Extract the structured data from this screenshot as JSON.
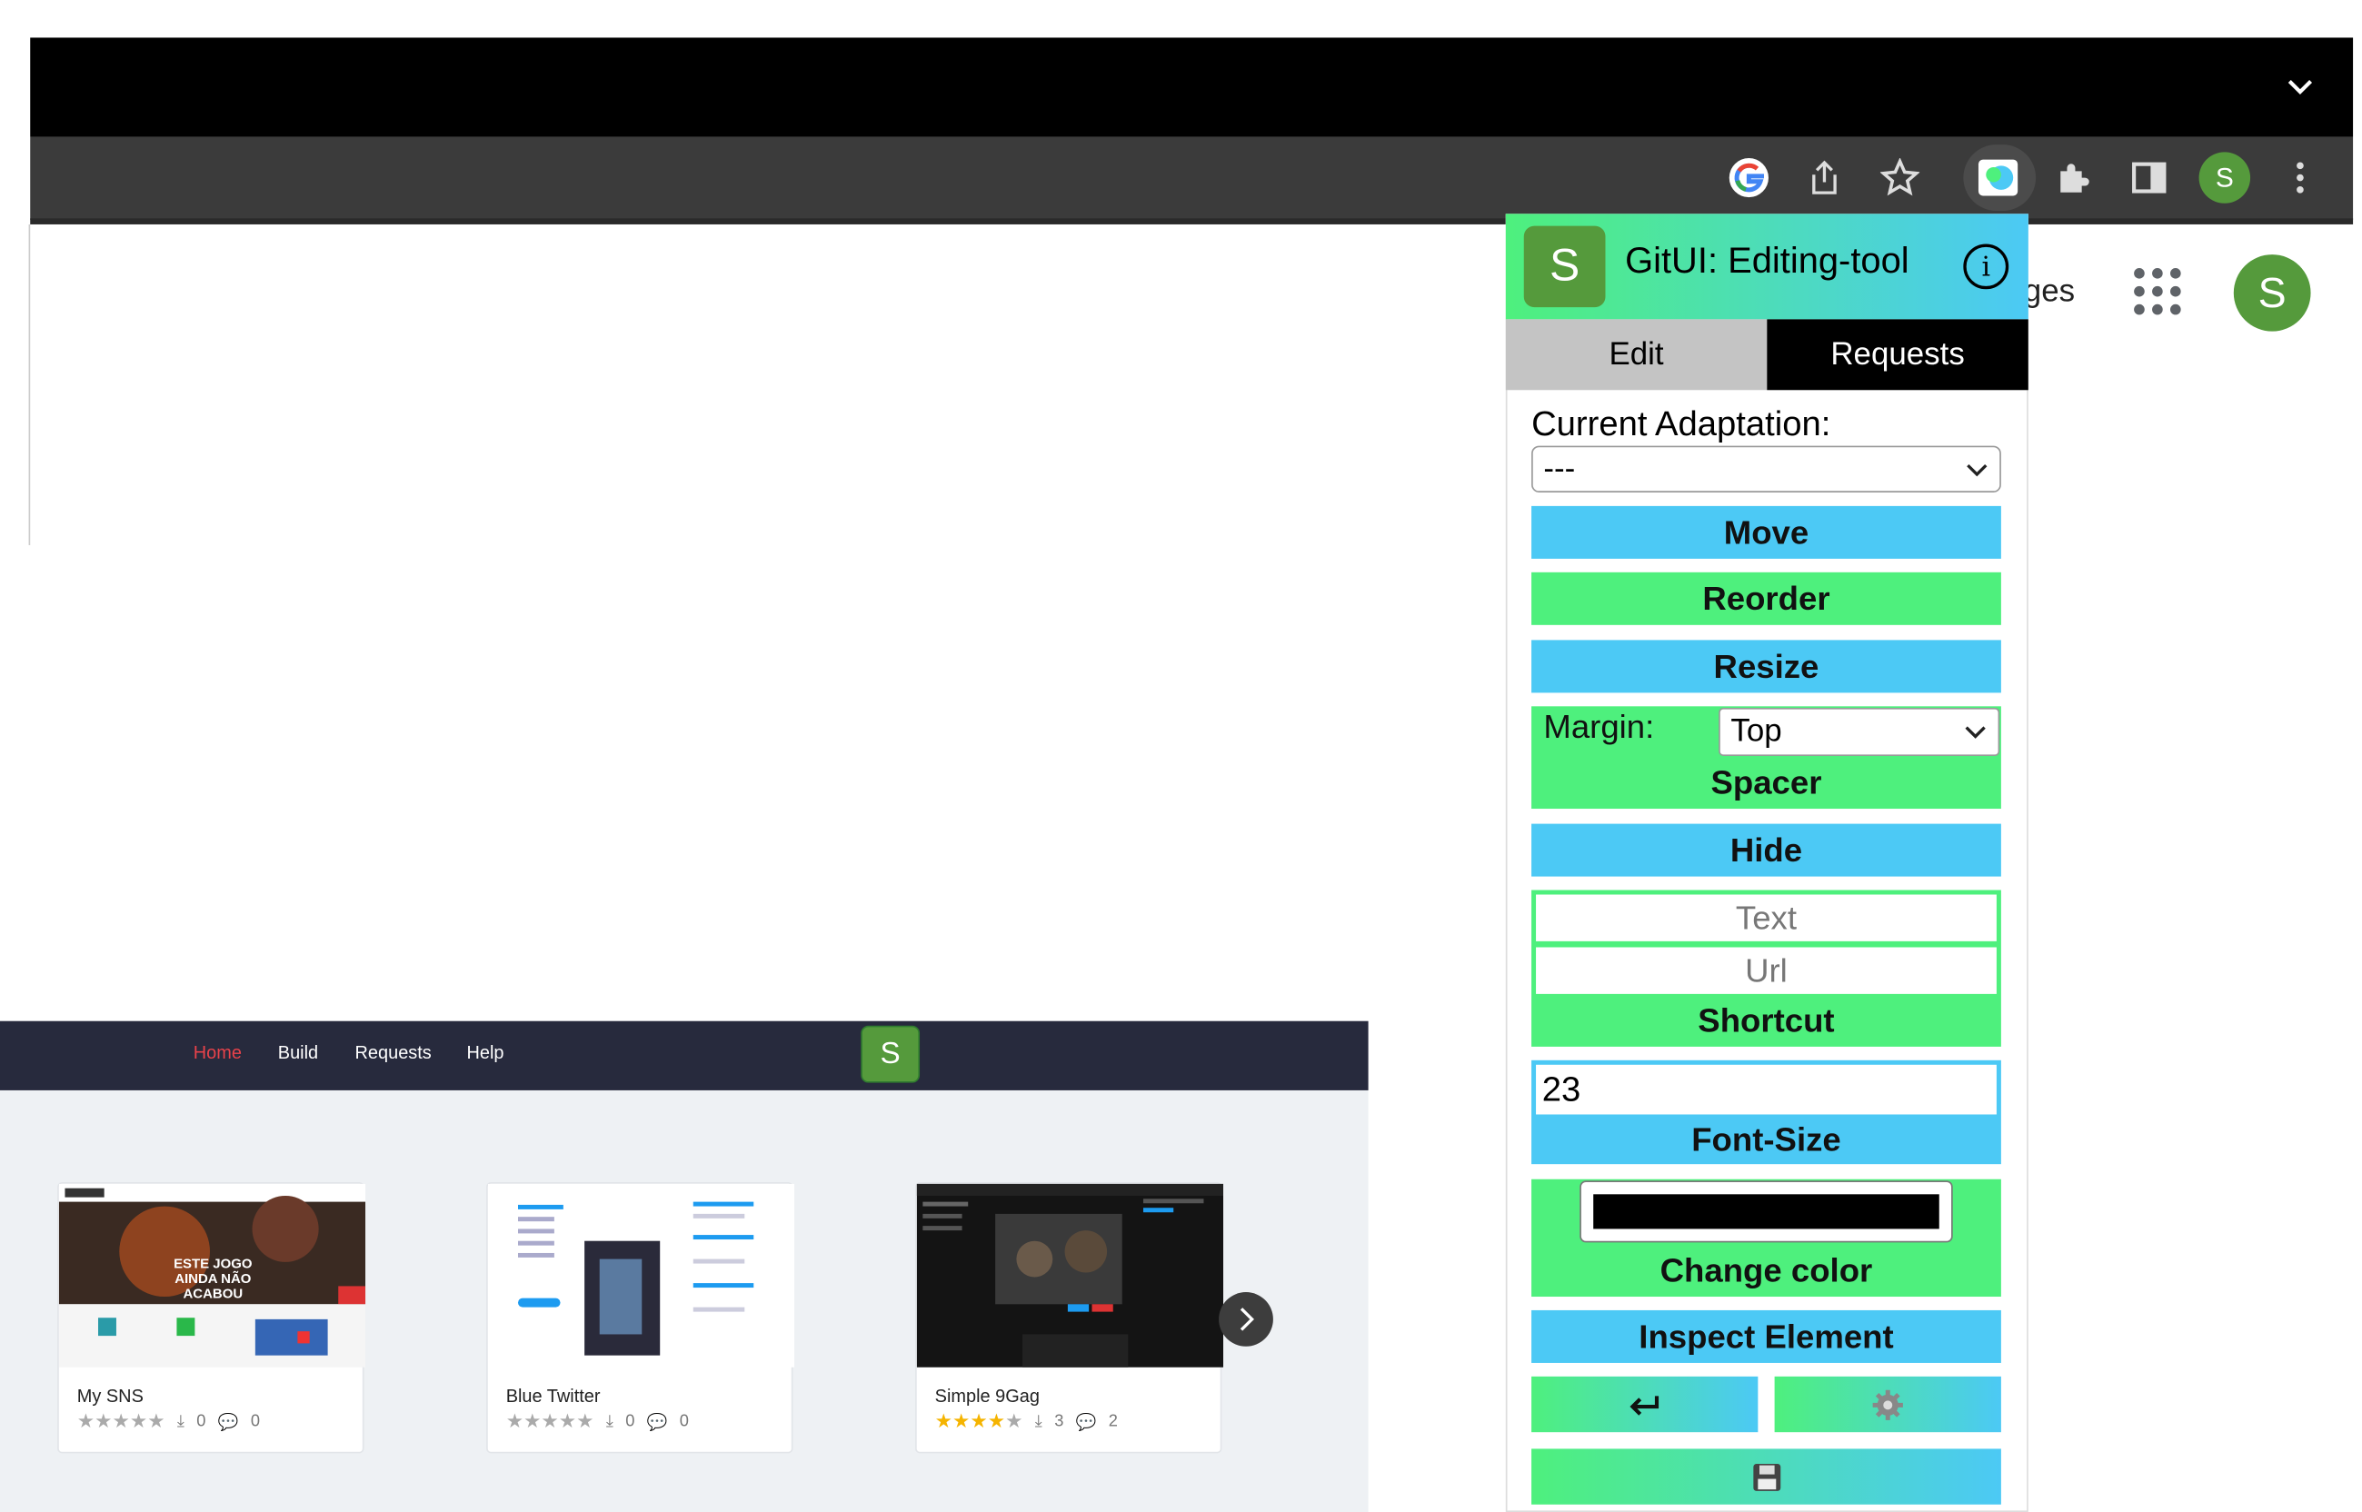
{
  "browser": {
    "toolbar_icons": [
      "google-icon",
      "share-icon",
      "star-icon",
      "extension-gitui-icon",
      "puzzle-icon",
      "sidepanel-icon",
      "profile-icon",
      "kebab-menu-icon"
    ],
    "profile_initial": "S"
  },
  "google_page": {
    "partial_link": "ges",
    "avatar_initial": "S"
  },
  "webapp": {
    "nav": {
      "home": "Home",
      "build": "Build",
      "requests": "Requests",
      "help": "Help",
      "avatar_initial": "S"
    },
    "cards": [
      {
        "title": "My SNS",
        "rating": 0,
        "downloads": "0",
        "comments": "0"
      },
      {
        "title": "Blue Twitter",
        "rating": 0,
        "downloads": "0",
        "comments": "0"
      },
      {
        "title": "Simple 9Gag",
        "rating": 3.5,
        "downloads": "3",
        "comments": "2"
      }
    ],
    "thumb_text": {
      "sns": "ESTE JOGO AINDA NÃO ACABOU"
    }
  },
  "panel": {
    "logo_initial": "S",
    "title": "GitUI: Editing-tool",
    "tabs": {
      "edit": "Edit",
      "requests": "Requests"
    },
    "current_adaptation_label": "Current Adaptation:",
    "current_adaptation_value": "---",
    "buttons": {
      "move": "Move",
      "reorder": "Reorder",
      "resize": "Resize",
      "margin_label": "Margin:",
      "margin_value": "Top",
      "spacer": "Spacer",
      "hide": "Hide",
      "text_placeholder": "Text",
      "url_placeholder": "Url",
      "shortcut": "Shortcut",
      "font_size_value": "23",
      "font_size": "Font-Size",
      "change_color": "Change color",
      "inspect": "Inspect Element"
    },
    "color_value": "#000000",
    "accent_green": "#4ef07d",
    "accent_blue": "#4cc9f5"
  }
}
